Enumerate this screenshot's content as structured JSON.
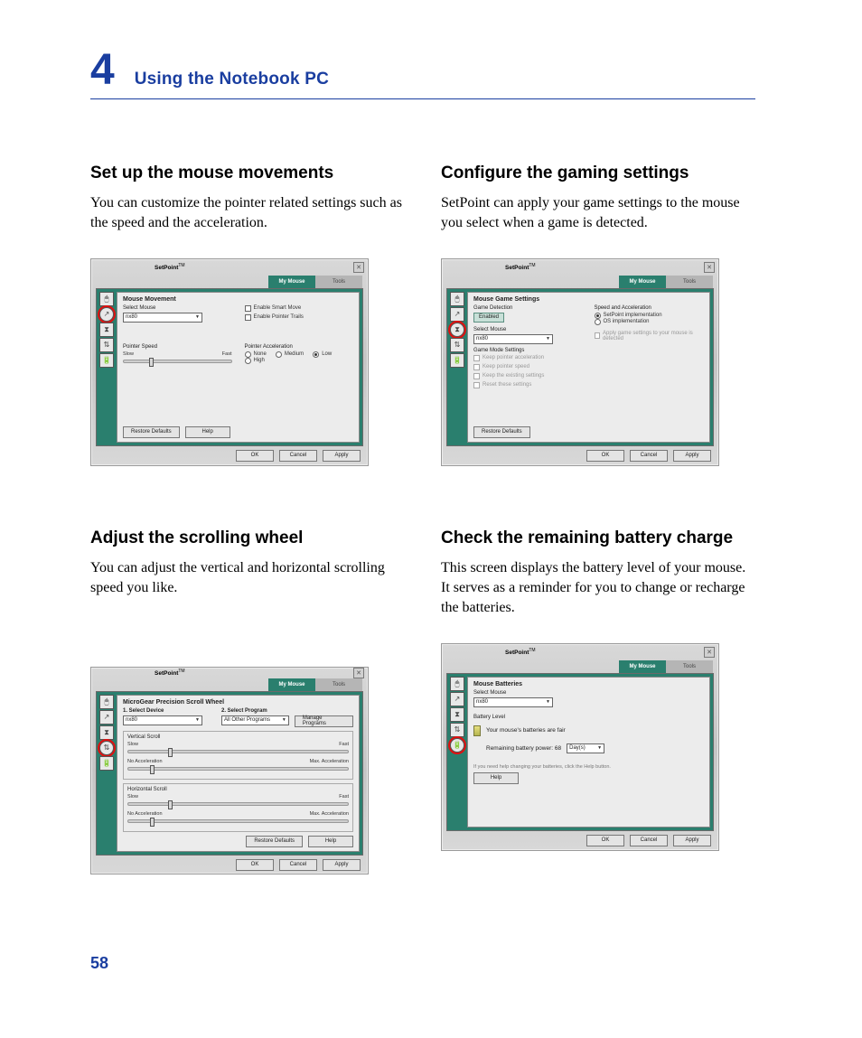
{
  "chapter": {
    "number": "4",
    "title": "Using the Notebook PC"
  },
  "page_number": "58",
  "sections": {
    "mouse_movements": {
      "title": "Set up the mouse movements",
      "body": "You can customize the pointer related settings such as the speed and the acceleration."
    },
    "gaming": {
      "title": "Configure the gaming settings",
      "body": "SetPoint can apply your game settings to the mouse you select when a game is detected."
    },
    "scroll": {
      "title": "Adjust the scrolling wheel",
      "body": "You can adjust the vertical and horizontal scrolling speed you like."
    },
    "battery": {
      "title": "Check the remaining battery charge",
      "body": "This screen displays the battery level of your mouse. It serves as a reminder for you to change or recharge the batteries."
    }
  },
  "setpoint_common": {
    "app_title": "SetPoint",
    "tm": "TM",
    "tab_mouse": "My Mouse",
    "tab_tools": "Tools",
    "btn_ok": "OK",
    "btn_cancel": "Cancel",
    "btn_apply": "Apply",
    "btn_help": "Help",
    "btn_restore": "Restore Defaults",
    "select_mouse_label": "Select Mouse",
    "mouse_value": "nx80"
  },
  "win_movement": {
    "panel_title": "Mouse Movement",
    "smart_move": "Enable Smart Move",
    "pointer_trails": "Enable Pointer Trails",
    "pointer_speed": "Pointer Speed",
    "slow": "Slow",
    "fast": "Fast",
    "pointer_accel": "Pointer Acceleration",
    "accel_none": "None",
    "accel_low": "Low",
    "accel_medium": "Medium",
    "accel_high": "High"
  },
  "win_gaming": {
    "panel_title": "Mouse Game Settings",
    "game_detection": "Game Detection",
    "enabled": "Enabled",
    "speed_accel": "Speed and Acceleration",
    "setpoint_impl": "SetPoint implementation",
    "os_impl": "OS implementation",
    "game_mode": "Game Mode Settings",
    "chk_keep_accel": "Keep pointer acceleration",
    "chk_keep_speed": "Keep pointer speed",
    "chk_enable_trails": "Keep the existing settings",
    "chk_reset": "Reset these settings",
    "apply_hint": "Apply game settings to your mouse is detected"
  },
  "win_scroll": {
    "panel_title": "MicroGear Precision Scroll Wheel",
    "sel_device": "1. Select Device",
    "sel_program": "2. Select Program",
    "all_other": "All Other Programs",
    "manage_programs": "Manage Programs",
    "vertical": "Vertical Scroll",
    "horizontal": "Horizontal Scroll",
    "slow": "Slow",
    "fast": "Fast",
    "no_accel": "No Acceleration",
    "max_accel": "Max. Acceleration"
  },
  "win_battery": {
    "panel_title": "Mouse Batteries",
    "level": "Battery Level",
    "status": "Your mouse's batteries are fair",
    "remaining_label": "Remaining battery power: 68",
    "days_unit": "Day(s)",
    "help_hint": "If you need help changing your batteries, click the Help button."
  }
}
